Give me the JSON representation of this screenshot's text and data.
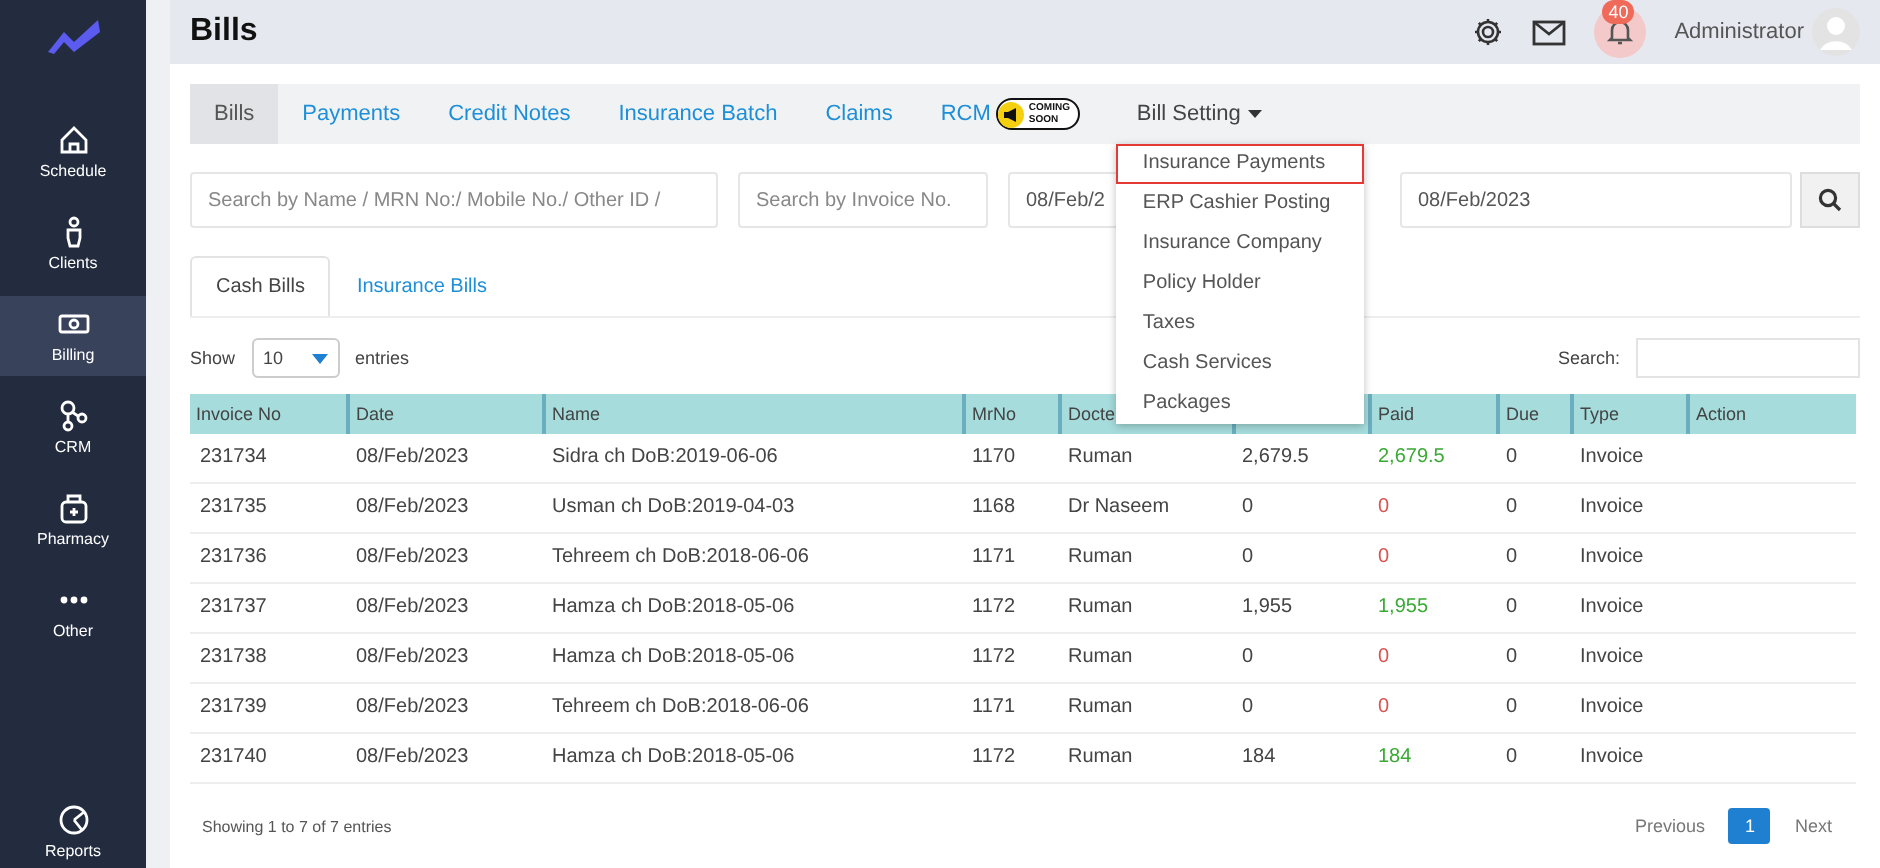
{
  "sidebar": {
    "items": [
      {
        "label": "Schedule",
        "selected": false
      },
      {
        "label": "Clients",
        "selected": false
      },
      {
        "label": "Billing",
        "selected": true
      },
      {
        "label": "CRM",
        "selected": false
      },
      {
        "label": "Pharmacy",
        "selected": false
      },
      {
        "label": "Other",
        "selected": false
      }
    ],
    "bottom_item": {
      "label": "Reports"
    }
  },
  "header": {
    "title": "Bills",
    "notification_count": "40",
    "user": "Administrator"
  },
  "tabs": [
    {
      "label": "Bills",
      "selected": true
    },
    {
      "label": "Payments",
      "selected": false
    },
    {
      "label": "Credit Notes",
      "selected": false
    },
    {
      "label": "Insurance Batch",
      "selected": false
    },
    {
      "label": "Claims",
      "selected": false
    },
    {
      "label": "RCM",
      "selected": false,
      "badge": "COMING SOON"
    },
    {
      "label": "Bill Setting",
      "selected": false,
      "dropdown": true
    }
  ],
  "bill_setting_menu": [
    {
      "label": "Insurance Payments",
      "highlighted": true
    },
    {
      "label": "ERP Cashier Posting",
      "highlighted": false
    },
    {
      "label": "Insurance Company",
      "highlighted": false
    },
    {
      "label": "Policy Holder",
      "highlighted": false
    },
    {
      "label": "Taxes",
      "highlighted": false
    },
    {
      "label": "Cash Services",
      "highlighted": false
    },
    {
      "label": "Packages",
      "highlighted": false
    }
  ],
  "filters": {
    "name_search": {
      "placeholder": "Search by Name / MRN No:/ Mobile No./ Other ID /"
    },
    "invoice_search": {
      "placeholder": "Search by Invoice No."
    },
    "date_from": {
      "value": "08/Feb/2"
    },
    "date_to": {
      "value": "08/Feb/2023"
    }
  },
  "bill_tabs": [
    {
      "label": "Cash Bills",
      "selected": true
    },
    {
      "label": "Insurance Bills",
      "selected": false
    }
  ],
  "table": {
    "show_label": "Show",
    "page_size": "10",
    "entries_label": "entries",
    "search_label": "Search:",
    "columns": [
      "Invoice No",
      "Date",
      "Name",
      "MrNo",
      "Docte",
      "",
      "Paid",
      "Due",
      "Type",
      "Action"
    ],
    "rows": [
      {
        "invoice": "231734",
        "date": "08/Feb/2023",
        "name": "Sidra ch DoB:2019-06-06",
        "mrno": "1170",
        "doctor": "Ruman",
        "total": "2,679.5",
        "paid": {
          "text": "2,679.5",
          "color": "#3aaa35"
        },
        "due": "0",
        "type": "Invoice"
      },
      {
        "invoice": "231735",
        "date": "08/Feb/2023",
        "name": "Usman ch DoB:2019-04-03",
        "mrno": "1168",
        "doctor": "Dr Naseem",
        "total": "0",
        "paid": {
          "text": "0",
          "color": "#d9534f"
        },
        "due": "0",
        "type": "Invoice"
      },
      {
        "invoice": "231736",
        "date": "08/Feb/2023",
        "name": "Tehreem ch DoB:2018-06-06",
        "mrno": "1171",
        "doctor": "Ruman",
        "total": "0",
        "paid": {
          "text": "0",
          "color": "#d9534f"
        },
        "due": "0",
        "type": "Invoice"
      },
      {
        "invoice": "231737",
        "date": "08/Feb/2023",
        "name": "Hamza ch DoB:2018-05-06",
        "mrno": "1172",
        "doctor": "Ruman",
        "total": "1,955",
        "paid": {
          "text": "1,955",
          "color": "#3aaa35"
        },
        "due": "0",
        "type": "Invoice"
      },
      {
        "invoice": "231738",
        "date": "08/Feb/2023",
        "name": "Hamza ch DoB:2018-05-06",
        "mrno": "1172",
        "doctor": "Ruman",
        "total": "0",
        "paid": {
          "text": "0",
          "color": "#d9534f"
        },
        "due": "0",
        "type": "Invoice"
      },
      {
        "invoice": "231739",
        "date": "08/Feb/2023",
        "name": "Tehreem ch DoB:2018-06-06",
        "mrno": "1171",
        "doctor": "Ruman",
        "total": "0",
        "paid": {
          "text": "0",
          "color": "#d9534f"
        },
        "due": "0",
        "type": "Invoice"
      },
      {
        "invoice": "231740",
        "date": "08/Feb/2023",
        "name": "Hamza ch DoB:2018-05-06",
        "mrno": "1172",
        "doctor": "Ruman",
        "total": "184",
        "paid": {
          "text": "184",
          "color": "#3aaa35"
        },
        "due": "0",
        "type": "Invoice"
      }
    ],
    "footer": "Showing 1 to 7 of 7 entries",
    "pagination": [
      {
        "label": "Previous",
        "selected": false
      },
      {
        "label": "1",
        "selected": true
      },
      {
        "label": "Next",
        "selected": false
      }
    ]
  }
}
